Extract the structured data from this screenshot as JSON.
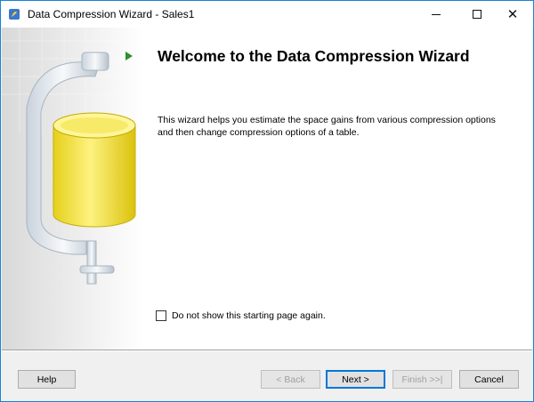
{
  "window": {
    "title": "Data Compression Wizard - Sales1"
  },
  "page": {
    "heading": "Welcome to the Data Compression Wizard",
    "description": "This wizard helps you estimate the space gains from various compression options and then change compression options of a table.",
    "checkbox_label": "Do not show this starting page again.",
    "checkbox_checked": false
  },
  "buttons": {
    "help": "Help",
    "back": "< Back",
    "next": "Next >",
    "finish": "Finish >>|",
    "cancel": "Cancel"
  },
  "colors": {
    "accent": "#0078d7",
    "arrow": "#2f8f2f",
    "cylinder": "#f2df30"
  }
}
